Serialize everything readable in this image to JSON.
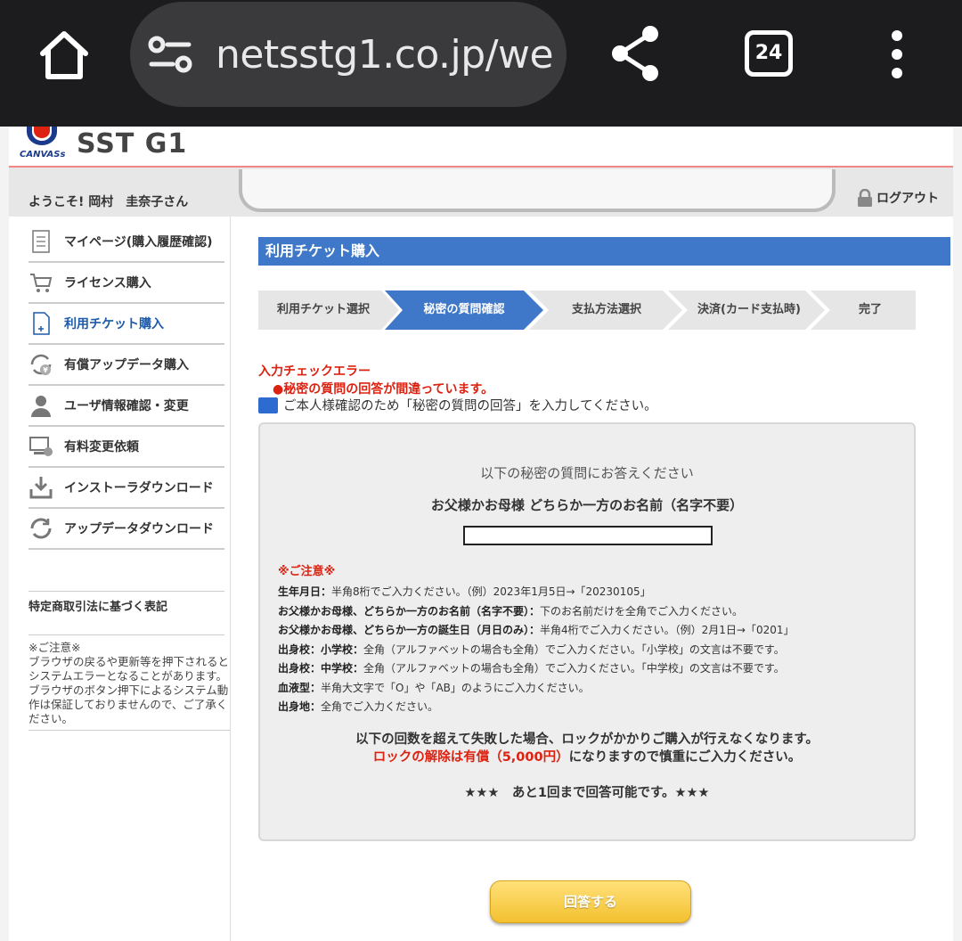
{
  "browser": {
    "url": "netsstg1.co.jp/we",
    "tab_count": "24"
  },
  "brand": {
    "logo_sub": "CANVASs",
    "logo_name": "SST G1"
  },
  "header": {
    "welcome": "ようこそ! 岡村　圭奈子さん",
    "logout": "ログアウト"
  },
  "sidebar": {
    "items": [
      {
        "label": "マイページ(購入履歴確認)",
        "icon": "document-icon"
      },
      {
        "label": "ライセンス購入",
        "icon": "cart-icon"
      },
      {
        "label": "利用チケット購入",
        "icon": "ticket-page-icon"
      },
      {
        "label": "有償アップデータ購入",
        "icon": "paid-update-icon"
      },
      {
        "label": "ユーザ情報確認・変更",
        "icon": "user-icon"
      },
      {
        "label": "有料変更依頼",
        "icon": "computer-icon"
      },
      {
        "label": "インストーラダウンロード",
        "icon": "download-icon"
      },
      {
        "label": "アップデータダウンロード",
        "icon": "refresh-icon"
      }
    ],
    "legal": "特定商取引法に基づく表記",
    "note_title": "※ご注意※",
    "note_body": "ブラウザの戻るや更新等を押下されるとシステムエラーとなることがあります。ブラウザのボタン押下によるシステム動作は保証しておりませんので、ご了承ください。"
  },
  "main": {
    "title": "利用チケット購入",
    "steps": [
      "利用チケット選択",
      "秘密の質問確認",
      "支払方法選択",
      "決済(カード支払時)",
      "完了"
    ],
    "active_step": 1,
    "error_title": "入力チェックエラー",
    "error_msg": "●秘密の質問の回答が間違っています。",
    "instruction": "ご本人様確認のため「秘密の質問の回答」を入力してください。",
    "question_lead": "以下の秘密の質問にお答えください",
    "question": "お父様かお母様 どちらか一方のお名前（名字不要）",
    "answer_value": "",
    "caution_title": "※ご注意※",
    "caution_rows": [
      {
        "label": "生年月日：",
        "text": "半角8桁でご入力ください。（例）2023年1月5日→「20230105」"
      },
      {
        "label": "お父様かお母様、どちらか一方のお名前（名字不要）：",
        "text": "下のお名前だけを全角でご入力ください。"
      },
      {
        "label": "お父様かお母様、どちらか一方の誕生日（月日のみ）：",
        "text": "半角4桁でご入力ください。（例）2月1日→「0201」"
      },
      {
        "label": "出身校：小学校：",
        "text": "全角（アルファベットの場合も全角）でご入力ください。「小学校」の文言は不要です。"
      },
      {
        "label": "出身校：中学校：",
        "text": "全角（アルファベットの場合も全角）でご入力ください。「中学校」の文言は不要です。"
      },
      {
        "label": "血液型：",
        "text": "半角大文字で「O」や「AB」のようにご入力ください。"
      },
      {
        "label": "出身地：",
        "text": "全角でご入力ください。"
      }
    ],
    "warn_line1": "以下の回数を超えて失敗した場合、ロックがかかりご購入が行えなくなります。",
    "warn_line2_red": "ロックの解除は有償（5,000円）",
    "warn_line2_rest": "になりますので慎重にご入力ください。",
    "remaining": "★★★　あと1回まで回答可能です。★★★",
    "submit_label": "回答する"
  },
  "colors": {
    "accent_blue": "#3f78c8",
    "error_red": "#d21111",
    "button_yellow": "#f3c12f"
  }
}
